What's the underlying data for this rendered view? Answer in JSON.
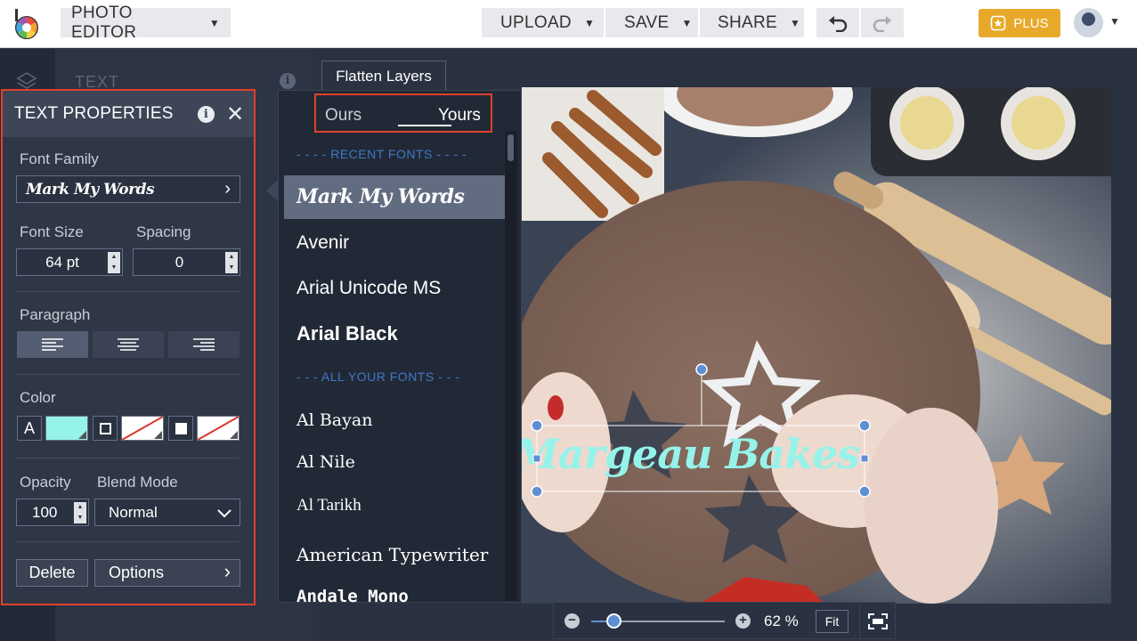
{
  "topbar": {
    "app_menu": "PHOTO EDITOR",
    "upload": "UPLOAD",
    "save": "SAVE",
    "share": "SHARE",
    "plus": "PLUS"
  },
  "sidebar": {
    "ghost_title": "TEXT"
  },
  "flatten_layers": "Flatten Layers",
  "text_properties": {
    "title": "TEXT PROPERTIES",
    "font_family_label": "Font Family",
    "font_family_value": "Mark My Words",
    "font_size_label": "Font Size",
    "font_size_value": "64 pt",
    "spacing_label": "Spacing",
    "spacing_value": "0",
    "paragraph_label": "Paragraph",
    "color_label": "Color",
    "color_text_glyph": "A",
    "opacity_label": "Opacity",
    "opacity_value": "100",
    "blend_mode_label": "Blend Mode",
    "blend_mode_value": "Normal",
    "delete_label": "Delete",
    "options_label": "Options",
    "colors": {
      "text_fill": "#96f3ea",
      "accent_border": "#e0412c"
    }
  },
  "font_list": {
    "tab_ours": "Ours",
    "tab_yours": "Yours",
    "recent_header": "- - - - RECENT FONTS - - - -",
    "recent": [
      "Mark My Words",
      "Avenir",
      "Arial Unicode MS",
      "Arial Black"
    ],
    "all_header": "- - - ALL YOUR FONTS - - -",
    "all": [
      "Al Bayan",
      "Al Nile",
      "Al Tarikh",
      "American Typewriter",
      "Andale Mono"
    ]
  },
  "canvas": {
    "text_layer": "Margeau Bakes"
  },
  "zoom": {
    "value": "62 %",
    "fit": "Fit",
    "level": 0.17
  }
}
